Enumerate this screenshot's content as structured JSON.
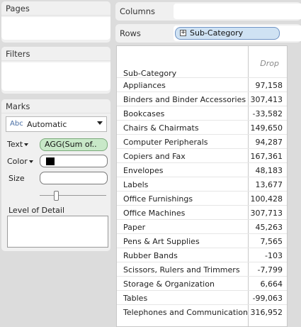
{
  "sidebar": {
    "pages_label": "Pages",
    "filters_label": "Filters",
    "marks": {
      "label": "Marks",
      "type_icon": "Abc",
      "type_value": "Automatic",
      "text_label": "Text",
      "text_pill": "AGG(Sum of..",
      "color_label": "Color",
      "color_swatch": "#000000",
      "size_label": "Size",
      "level_of_detail_label": "Level of Detail"
    }
  },
  "shelves": {
    "columns_label": "Columns",
    "rows_label": "Rows",
    "rows_pill": "Sub-Category"
  },
  "table": {
    "row_header": "Sub-Category",
    "column_header": "Drop",
    "rows": [
      {
        "category": "Appliances",
        "value": "97,158"
      },
      {
        "category": "Binders and Binder Accessories",
        "value": "307,413"
      },
      {
        "category": "Bookcases",
        "value": "-33,582"
      },
      {
        "category": "Chairs & Chairmats",
        "value": "149,650"
      },
      {
        "category": "Computer Peripherals",
        "value": "94,287"
      },
      {
        "category": "Copiers and Fax",
        "value": "167,361"
      },
      {
        "category": "Envelopes",
        "value": "48,183"
      },
      {
        "category": "Labels",
        "value": "13,677"
      },
      {
        "category": "Office Furnishings",
        "value": "100,428"
      },
      {
        "category": "Office Machines",
        "value": "307,713"
      },
      {
        "category": "Paper",
        "value": "45,263"
      },
      {
        "category": "Pens & Art Supplies",
        "value": "7,565"
      },
      {
        "category": "Rubber Bands",
        "value": "-103"
      },
      {
        "category": "Scissors, Rulers and Trimmers",
        "value": "-7,799"
      },
      {
        "category": "Storage & Organization",
        "value": "6,664"
      },
      {
        "category": "Tables",
        "value": "-99,063"
      },
      {
        "category": "Telephones and Communication",
        "value": "316,952"
      }
    ]
  }
}
